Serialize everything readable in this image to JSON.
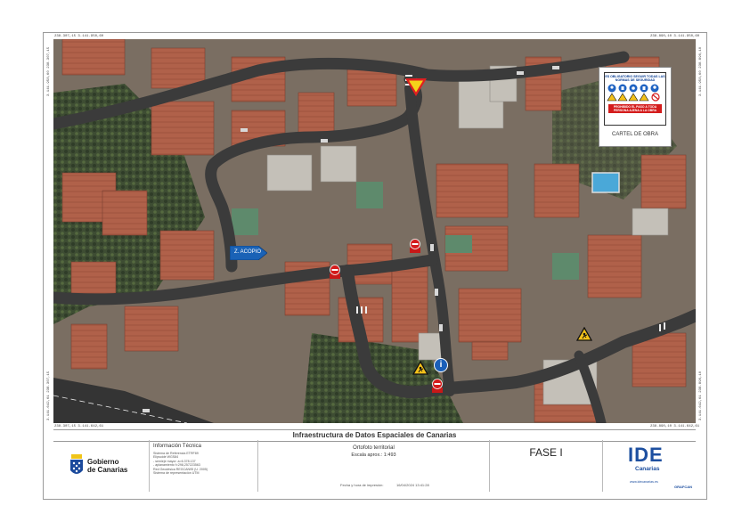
{
  "map": {
    "coords": {
      "top_left": "238.307,15  3.141.950,60",
      "top_right": "238.890,10  3.141.950,60",
      "bottom_left": "238.307,15  3.141.642,61",
      "bottom_right": "238.890,10  3.141.642,61",
      "left_top_v": "3.141.950,60  238.307,15",
      "left_bottom_v": "3.141.642,61  238.307,15",
      "right_top_v": "3.141.950,60  238.890,10",
      "right_bottom_v": "3.141.642,61  238.890,10"
    },
    "storage_label": "Z. ACOPIO",
    "info_sign_glyph": "i",
    "cartel": {
      "header": "ES OBLIGATORIO SEGUIR TODAS LAS NORMAS DE SEGURIDAD",
      "footer": "PROHIBIDO EL PASO A TODA PERSONA AJENA A LA OBRA",
      "label": "CARTEL DE OBRA"
    }
  },
  "footer": {
    "title": "Infraestructura de Datos Espaciales de Canarias",
    "gov_logo_line1": "Gobierno",
    "gov_logo_line2": "de Canarias",
    "tech_title": "Información Técnica",
    "tech_lines": [
      "Sistema de Referencia ETRF89",
      "Elipsoide WGS84",
      "- semieje mayor: a=6.378.137",
      "- aplanamiento f=298,257223563",
      "Red Geodésica REGCAN95 (U. 2005)",
      "Sistema de representación UTM"
    ],
    "product": "Ortofoto territorial",
    "scale": "Escala aprox.: 1:493",
    "print_date_label": "Fecha y hora de impresión:",
    "print_date": "16/04/2024 13:41:28",
    "phase": "FASE I",
    "ide_logo": "IDE",
    "ide_logo_sub": "Canarias",
    "ide_url": "www.idecanarias.es",
    "grafcan": "GRAFCAN"
  },
  "colors": {
    "road": "#3b3b3b",
    "roof_terracotta": "#b0614a",
    "acopio": "#1a62b6",
    "ide_blue": "#1d4fa0"
  }
}
